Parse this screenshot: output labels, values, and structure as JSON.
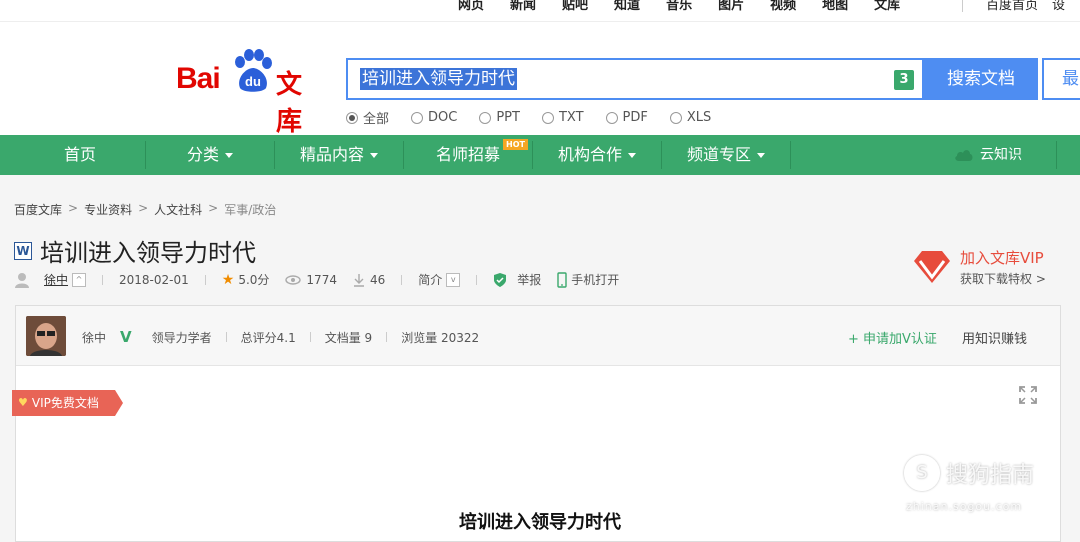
{
  "topnav": {
    "links": [
      "网页",
      "新闻",
      "贴吧",
      "知道",
      "音乐",
      "图片",
      "视频",
      "地图",
      "文库"
    ],
    "right": [
      "百度首页",
      "设"
    ]
  },
  "header": {
    "logo_text_left": "Bai",
    "logo_text_paw": "du",
    "logo_text_right": "文库",
    "search_query": "培训进入领导力时代",
    "search_badge": "3",
    "search_button": "搜索文档",
    "side_button": "最",
    "filters": [
      {
        "label": "全部",
        "selected": true
      },
      {
        "label": "DOC",
        "selected": false
      },
      {
        "label": "PPT",
        "selected": false
      },
      {
        "label": "TXT",
        "selected": false
      },
      {
        "label": "PDF",
        "selected": false
      },
      {
        "label": "XLS",
        "selected": false
      }
    ]
  },
  "mainnav": {
    "items": [
      "首页",
      "分类",
      "精品内容",
      "名师招募",
      "机构合作",
      "频道专区"
    ],
    "hot_badge": "HOT",
    "cloud": "云知识",
    "color": "#3aa86c"
  },
  "breadcrumb": [
    "百度文库",
    "专业资料",
    "人文社科",
    "军事/政治"
  ],
  "document": {
    "title": "培训进入领导力时代",
    "author": "徐中",
    "date": "2018-02-01",
    "score": "5.0分",
    "views": "1774",
    "downloads": "46",
    "intro": "简介",
    "report": "举报",
    "mobile": "手机打开"
  },
  "vip_join": {
    "title": "加入文库VIP",
    "subtitle": "获取下载特权 >"
  },
  "author_bar": {
    "name": "徐中",
    "role": "领导力学者",
    "total_score": "总评分4.1",
    "doc_count": "文档量 9",
    "view_count": "浏览量 20322",
    "apply": "+ 申请加V认证",
    "earn": "用知识赚钱"
  },
  "vip_ribbon": "VIP免费文档",
  "page_heading": "培训进入领导力时代",
  "watermark": {
    "text": "搜狗指南",
    "sub": "zhinan.sogou.com",
    "letter": "S"
  }
}
